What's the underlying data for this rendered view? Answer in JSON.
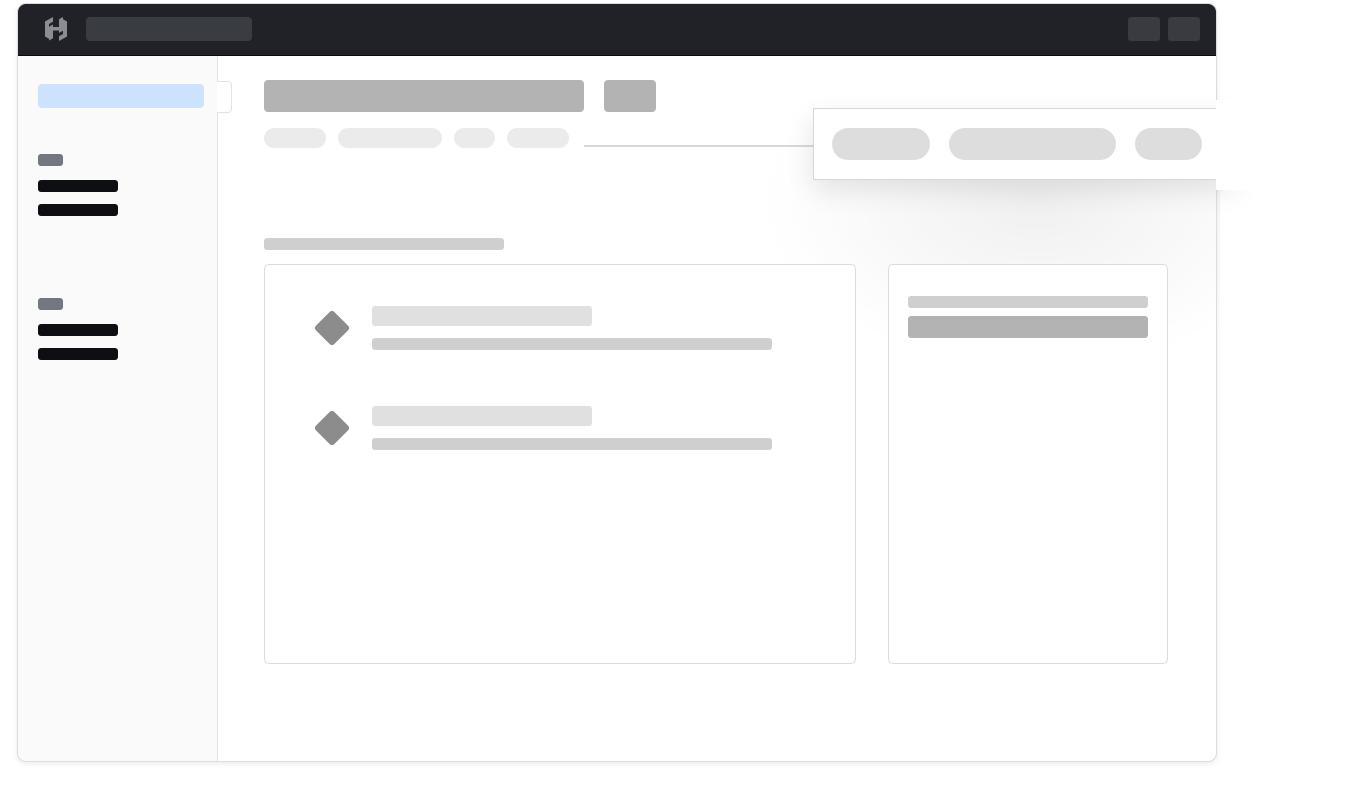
{
  "app": {
    "logo_icon": "hashicorp-logo-icon"
  },
  "colors": {
    "topbar": "#212227",
    "sidebar_active": "#cde3fd",
    "skeleton_dark": "#b3b3b3",
    "skeleton_light": "#e0e0e0",
    "skeleton_label": "#737780",
    "diamond_icon": "#8c8c8c"
  },
  "sidebar": {
    "sections": [
      {
        "items": 2
      },
      {
        "items": 2
      }
    ]
  },
  "main": {
    "filter_chips": 4,
    "resource_list": {
      "rows": 2,
      "row_icon": "diamond-icon"
    }
  },
  "popover": {
    "pills": 3
  }
}
